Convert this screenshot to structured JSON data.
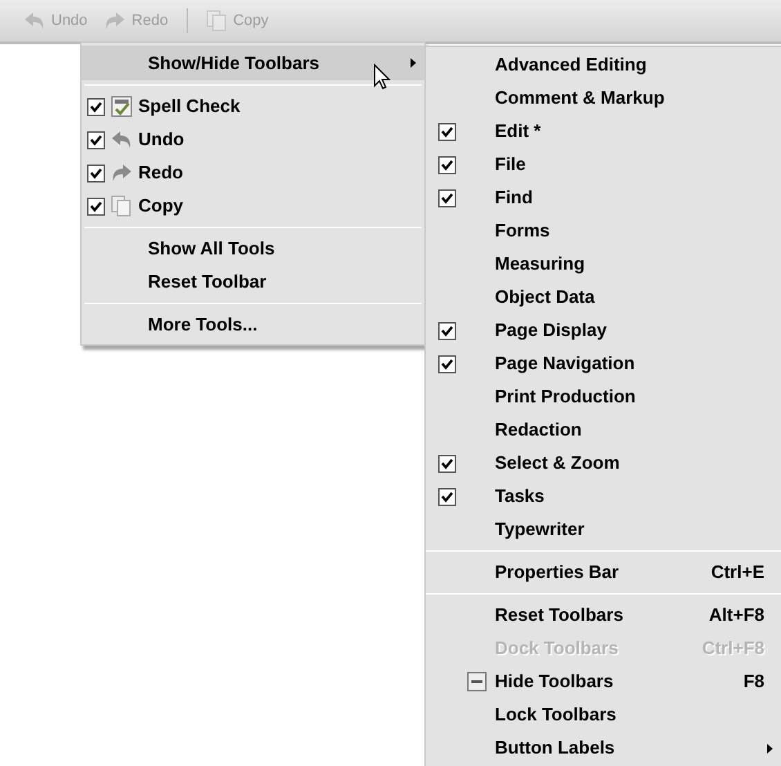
{
  "toolbar": {
    "buttons": [
      {
        "label": "Undo",
        "disabled": true
      },
      {
        "label": "Redo",
        "disabled": true
      },
      {
        "label": "Copy",
        "disabled": true
      }
    ]
  },
  "menu": {
    "items": [
      {
        "kind": "submenu",
        "label": "Show/Hide Toolbars",
        "selected": true
      },
      {
        "kind": "separator"
      },
      {
        "kind": "check",
        "label": "Spell Check",
        "checked": true
      },
      {
        "kind": "check",
        "label": "Undo",
        "checked": true
      },
      {
        "kind": "check",
        "label": "Redo",
        "checked": true
      },
      {
        "kind": "check",
        "label": "Copy",
        "checked": true
      },
      {
        "kind": "separator"
      },
      {
        "kind": "command",
        "label": "Show All Tools"
      },
      {
        "kind": "command",
        "label": "Reset Toolbar"
      },
      {
        "kind": "separator"
      },
      {
        "kind": "command",
        "label": "More Tools..."
      }
    ]
  },
  "submenu": {
    "items": [
      {
        "kind": "check",
        "label": "Advanced Editing",
        "checked": false
      },
      {
        "kind": "check",
        "label": "Comment & Markup",
        "checked": false
      },
      {
        "kind": "check",
        "label": "Edit *",
        "checked": true
      },
      {
        "kind": "check",
        "label": "File",
        "checked": true
      },
      {
        "kind": "check",
        "label": "Find",
        "checked": true
      },
      {
        "kind": "check",
        "label": "Forms",
        "checked": false
      },
      {
        "kind": "check",
        "label": "Measuring",
        "checked": false
      },
      {
        "kind": "check",
        "label": "Object Data",
        "checked": false
      },
      {
        "kind": "check",
        "label": "Page Display",
        "checked": true
      },
      {
        "kind": "check",
        "label": "Page Navigation",
        "checked": true
      },
      {
        "kind": "check",
        "label": "Print Production",
        "checked": false
      },
      {
        "kind": "check",
        "label": "Redaction",
        "checked": false
      },
      {
        "kind": "check",
        "label": "Select & Zoom",
        "checked": true
      },
      {
        "kind": "check",
        "label": "Tasks",
        "checked": true
      },
      {
        "kind": "check",
        "label": "Typewriter",
        "checked": false
      },
      {
        "kind": "separator"
      },
      {
        "kind": "command",
        "label": "Properties Bar",
        "shortcut": "Ctrl+E",
        "disabled": false
      },
      {
        "kind": "separator"
      },
      {
        "kind": "command",
        "label": "Reset Toolbars",
        "shortcut": "Alt+F8",
        "disabled": false
      },
      {
        "kind": "command",
        "label": "Dock Toolbars",
        "shortcut": "Ctrl+F8",
        "disabled": true
      },
      {
        "kind": "iconcommand",
        "label": "Hide Toolbars",
        "shortcut": "F8",
        "disabled": false
      },
      {
        "kind": "command",
        "label": "Lock Toolbars",
        "disabled": false
      },
      {
        "kind": "submenu",
        "label": "Button Labels"
      }
    ]
  }
}
